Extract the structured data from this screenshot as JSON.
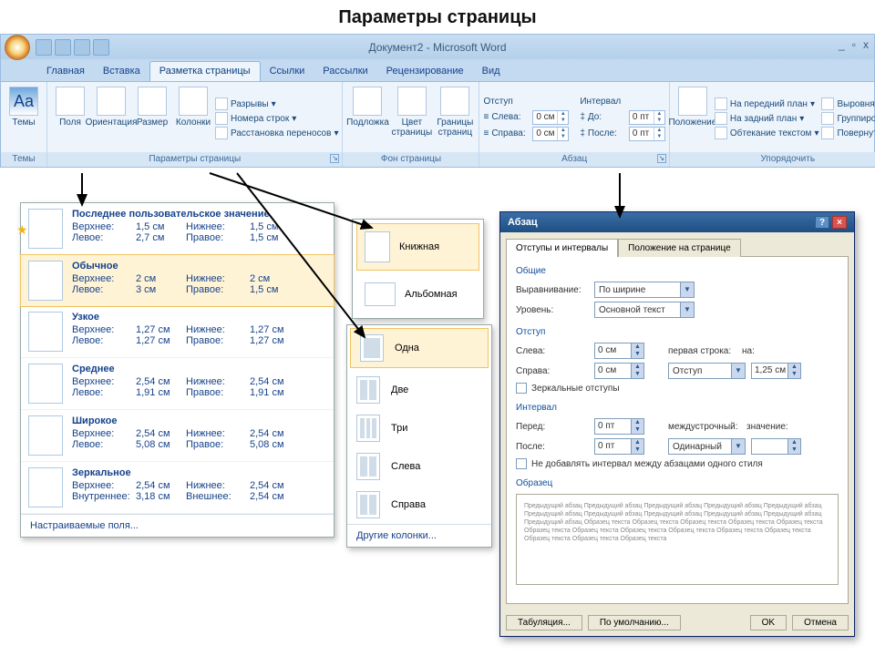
{
  "page_heading": "Параметры страницы",
  "titlebar": {
    "doc_title": "Документ2 - Microsoft Word",
    "min": "_",
    "max": "▫",
    "close": "x"
  },
  "tabs": [
    "Главная",
    "Вставка",
    "Разметка страницы",
    "Ссылки",
    "Рассылки",
    "Рецензирование",
    "Вид"
  ],
  "active_tab": 2,
  "ribbon": {
    "themes": {
      "label": "Темы",
      "btn": "Темы"
    },
    "page_setup": {
      "label": "Параметры страницы",
      "margins_btn": "Поля",
      "orientation_btn": "Ориентация",
      "size_btn": "Размер",
      "columns_btn": "Колонки",
      "breaks": "Разрывы",
      "line_numbers": "Номера строк",
      "hyphenation": "Расстановка переносов"
    },
    "page_bg": {
      "label": "Фон страницы",
      "watermark": "Подложка",
      "page_color": "Цвет страницы",
      "borders": "Границы страниц"
    },
    "paragraph": {
      "label": "Абзац",
      "indent_header": "Отступ",
      "spacing_header": "Интервал",
      "left_label": "Слева:",
      "right_label": "Справа:",
      "before_label": "До:",
      "after_label": "После:",
      "left_val": "0 см",
      "right_val": "0 см",
      "before_val": "0 пт",
      "after_val": "0 пт"
    },
    "arrange": {
      "label": "Упорядочить",
      "position": "Положение",
      "bring_front": "На передний план",
      "send_back": "На задний план",
      "text_wrap": "Обтекание текстом",
      "align": "Выровнять",
      "group": "Группировать",
      "rotate": "Повернуть"
    }
  },
  "margins_dd": {
    "items": [
      {
        "name": "Последнее пользовательское значение",
        "top": "1,5 см",
        "bottom": "1,5 см",
        "left": "2,7 см",
        "right": "1,5 см",
        "star": true
      },
      {
        "name": "Обычное",
        "top": "2 см",
        "bottom": "2 см",
        "left": "3 см",
        "right": "1,5 см",
        "sel": true
      },
      {
        "name": "Узкое",
        "top": "1,27 см",
        "bottom": "1,27 см",
        "left": "1,27 см",
        "right": "1,27 см"
      },
      {
        "name": "Среднее",
        "top": "2,54 см",
        "bottom": "2,54 см",
        "left": "1,91 см",
        "right": "1,91 см"
      },
      {
        "name": "Широкое",
        "top": "2,54 см",
        "bottom": "2,54 см",
        "left": "5,08 см",
        "right": "5,08 см"
      },
      {
        "name": "Зеркальное",
        "top": "2,54 см",
        "bottom": "2,54 см",
        "left": "3,18 см",
        "right": "2,54 см",
        "inner_label": "Внутреннее:",
        "outer_label": "Внешнее:"
      }
    ],
    "labels": {
      "top": "Верхнее:",
      "bottom": "Нижнее:",
      "left": "Левое:",
      "right": "Правое:"
    },
    "footer": "Настраиваемые поля..."
  },
  "orient_dd": {
    "portrait": "Книжная",
    "landscape": "Альбомная"
  },
  "cols_dd": {
    "items": [
      "Одна",
      "Две",
      "Три",
      "Слева",
      "Справа"
    ],
    "footer": "Другие колонки..."
  },
  "dialog": {
    "title": "Абзац",
    "tab1": "Отступы и интервалы",
    "tab2": "Положение на странице",
    "general": "Общие",
    "alignment_label": "Выравнивание:",
    "alignment_val": "По ширине",
    "level_label": "Уровень:",
    "level_val": "Основной текст",
    "indent": "Отступ",
    "left_label": "Слева:",
    "left_val": "0 см",
    "right_label": "Справа:",
    "right_val": "0 см",
    "firstline_label": "первая строка:",
    "firstline_val": "Отступ",
    "by_label": "на:",
    "by_val": "1,25 см",
    "mirror_chk": "Зеркальные отступы",
    "spacing": "Интервал",
    "before_label": "Перед:",
    "before_val": "0 пт",
    "after_label": "После:",
    "after_val": "0 пт",
    "line_label": "междустрочный:",
    "line_val": "Одинарный",
    "line_at_label": "значение:",
    "nospace_chk": "Не добавлять интервал между абзацами одного стиля",
    "preview": "Образец",
    "preview_text": "Предыдущий абзац Предыдущий абзац Предыдущий абзац Предыдущий абзац Предыдущий абзац Предыдущий абзац Предыдущий абзац Предыдущий абзац Предыдущий абзац Предыдущий абзац Предыдущий абзац\n        Образец текста Образец текста Образец текста Образец текста Образец текста Образец текста Образец текста Образец текста Образец текста Образец текста Образец текста Образец текста Образец текста Образец текста",
    "tabs_btn": "Табуляция...",
    "default_btn": "По умолчанию...",
    "ok_btn": "OK",
    "cancel_btn": "Отмена"
  }
}
